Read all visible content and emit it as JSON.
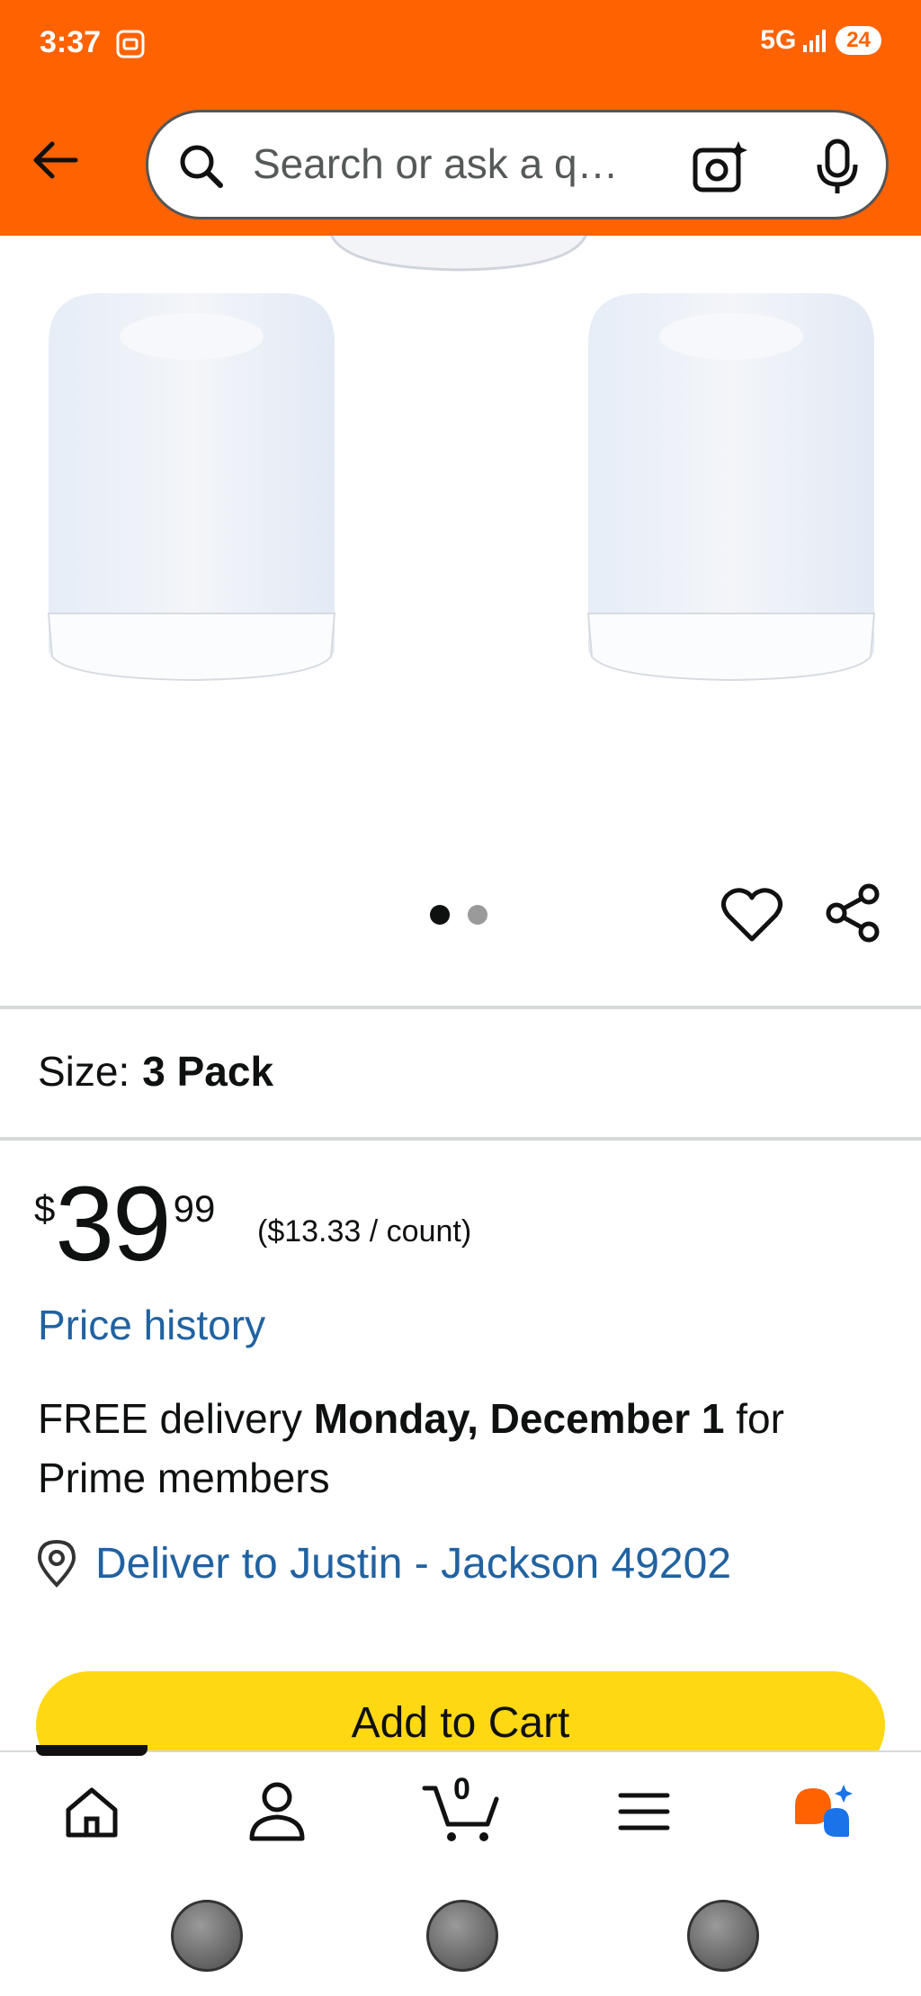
{
  "status_bar": {
    "time": "3:37",
    "network": "5G",
    "battery": "24"
  },
  "header": {
    "search_placeholder": "Search or ask a q…",
    "accent_color": "#ff6200"
  },
  "gallery": {
    "image_count": 2,
    "active_index": 0
  },
  "size": {
    "label": "Size:",
    "value": "3 Pack"
  },
  "price": {
    "symbol": "$",
    "whole": "39",
    "fraction": "99",
    "unit_price": "($13.33 / count)"
  },
  "price_history_link": "Price history",
  "delivery": {
    "prefix": "FREE delivery ",
    "date": "Monday, December 1",
    "suffix": " for Prime members"
  },
  "deliver_to": "Deliver to Justin - Jackson 49202",
  "add_to_cart": "Add to Cart",
  "bottom_nav": {
    "items": [
      "home",
      "account",
      "cart",
      "menu",
      "rufus"
    ],
    "cart_count": "0"
  },
  "colors": {
    "link": "#2162a1",
    "add_to_cart_bg": "#ffd814"
  }
}
